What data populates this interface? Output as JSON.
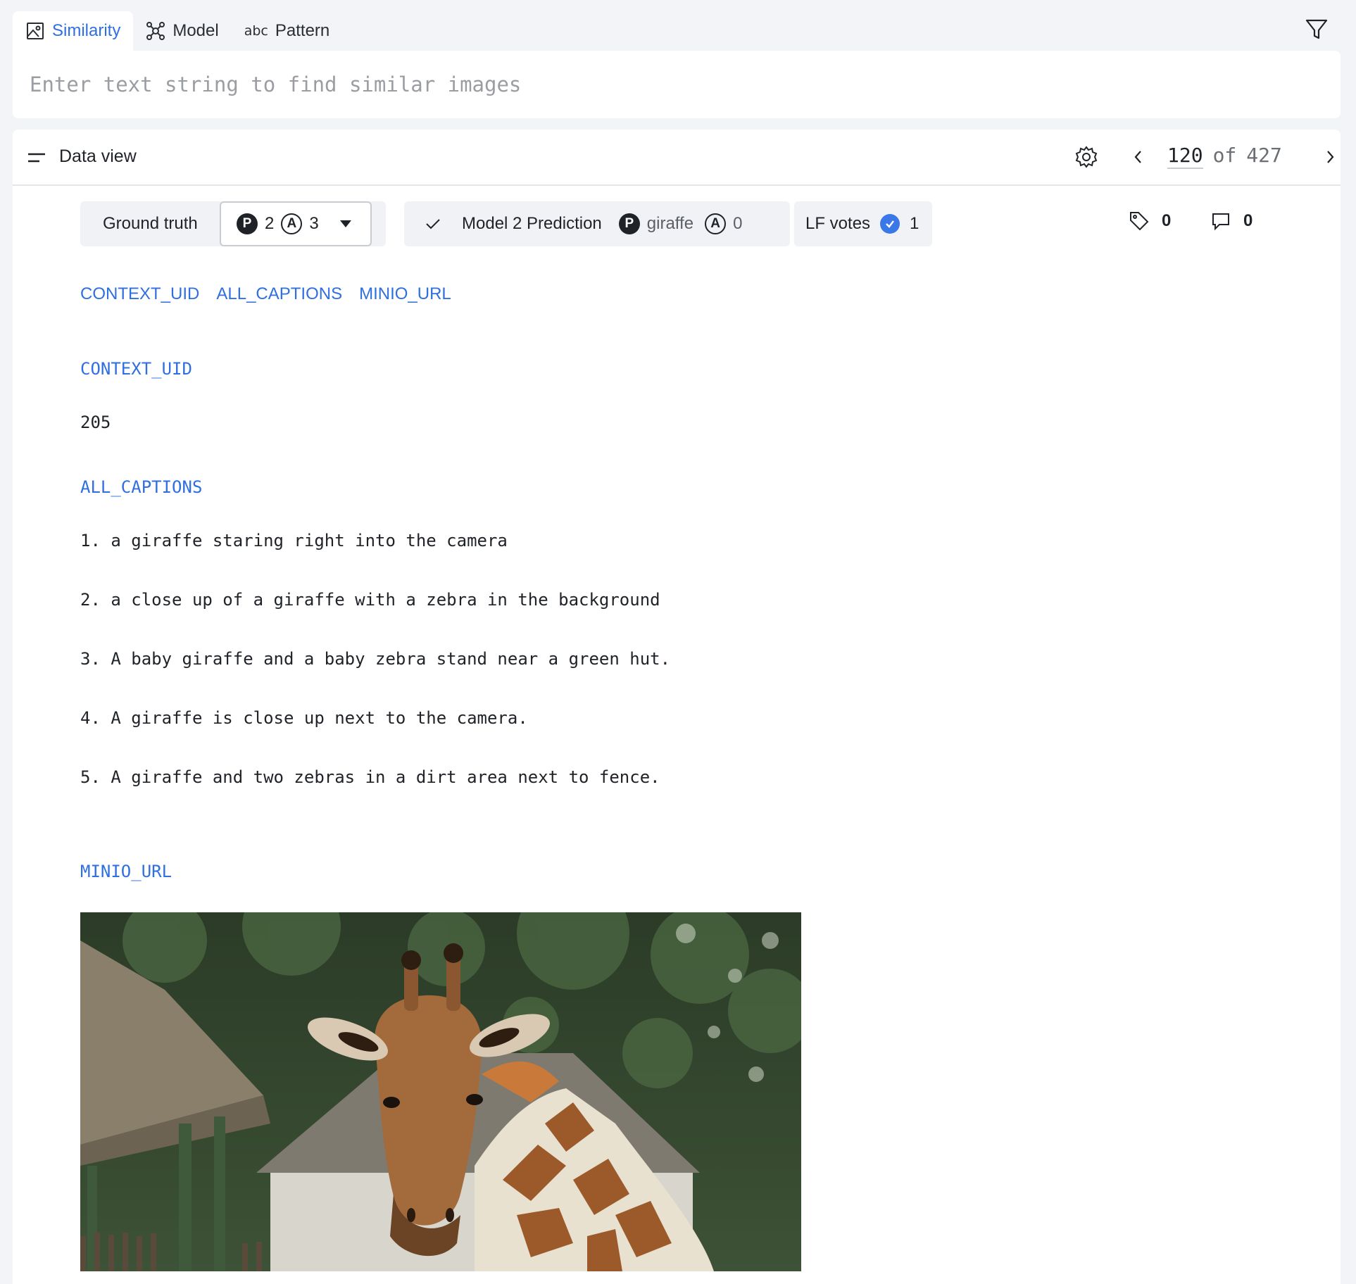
{
  "search": {
    "tabs": [
      {
        "label": "Similarity",
        "icon": "image-icon",
        "active": true
      },
      {
        "label": "Model",
        "icon": "model-graph-icon",
        "active": false
      },
      {
        "label": "Pattern",
        "icon": "abc-icon",
        "active": false
      }
    ],
    "abc_glyph": "abc",
    "placeholder": "Enter text string to find similar images",
    "value": ""
  },
  "panel": {
    "title": "Data view",
    "pager": {
      "current": "120",
      "of_label": "of",
      "total": "427"
    }
  },
  "labels": {
    "ground_truth": {
      "label": "Ground truth",
      "p_badge": "P",
      "p_count": "2",
      "a_badge": "A",
      "a_count": "3"
    },
    "model": {
      "label": "Model 2 Prediction",
      "p_badge": "P",
      "p_value": "giraffe",
      "a_badge": "A",
      "a_value": "0"
    },
    "lf_votes": {
      "label": "LF votes",
      "count": "1"
    },
    "tags_count": "0",
    "comments_count": "0"
  },
  "fields": {
    "links": [
      "CONTEXT_UID",
      "ALL_CAPTIONS",
      "MINIO_URL"
    ],
    "context_uid": {
      "title": "CONTEXT_UID",
      "value": "205"
    },
    "all_captions": {
      "title": "ALL_CAPTIONS",
      "items": [
        "1. a giraffe staring right into the camera",
        "2. a close up of a giraffe with a zebra in the background",
        "3. A baby giraffe and a baby zebra stand near a green hut.",
        "4. A giraffe is close up next to the camera.",
        "5. A giraffe and two zebras in a dirt area next to fence."
      ]
    },
    "minio_url": {
      "title": "MINIO_URL"
    }
  },
  "colors": {
    "accent": "#2f6fe0",
    "lf_check": "#3b78e7"
  }
}
